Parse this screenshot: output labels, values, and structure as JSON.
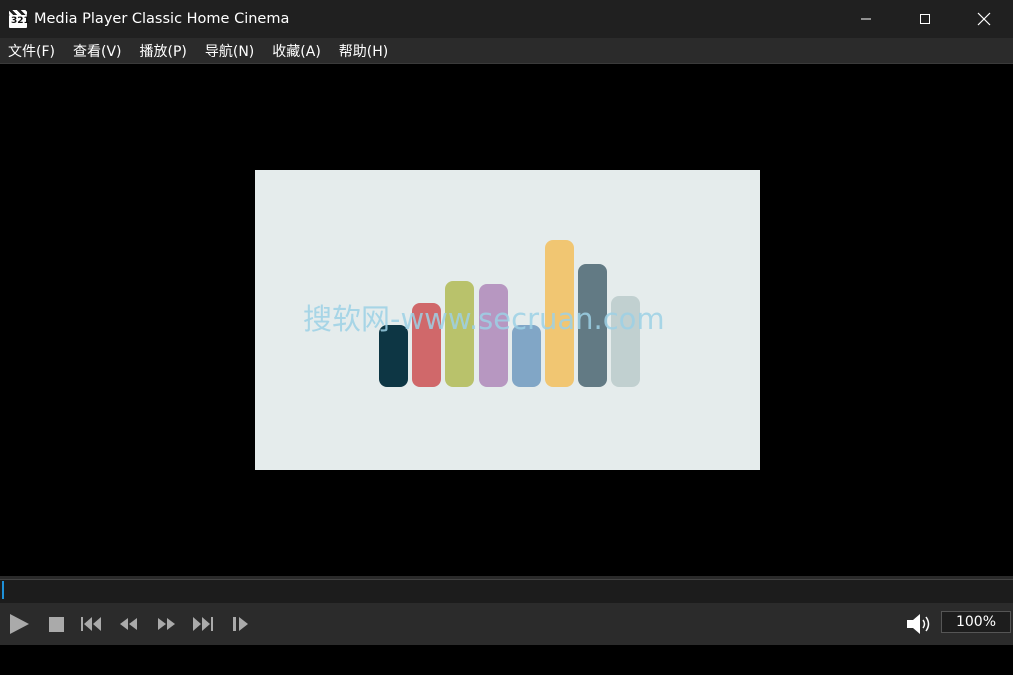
{
  "window": {
    "title": "Media Player Classic Home Cinema",
    "icon_number": "321"
  },
  "menu": [
    {
      "label": "文件(F)"
    },
    {
      "label": "查看(V)"
    },
    {
      "label": "播放(P)"
    },
    {
      "label": "导航(N)"
    },
    {
      "label": "收藏(A)"
    },
    {
      "label": "帮助(H)"
    }
  ],
  "video": {
    "background": "#e5ecec",
    "watermark": "搜软网-www.secruan.com",
    "bars": [
      {
        "color": "#0d3644",
        "level": 0.42
      },
      {
        "color": "#d0686a",
        "level": 0.57
      },
      {
        "color": "#b9c26b",
        "level": 0.72
      },
      {
        "color": "#b797c1",
        "level": 0.7
      },
      {
        "color": "#81a6c6",
        "level": 0.42
      },
      {
        "color": "#f1c672",
        "level": 1.0
      },
      {
        "color": "#627a84",
        "level": 0.84
      },
      {
        "color": "#c1d0d0",
        "level": 0.62
      }
    ]
  },
  "seekbar": {
    "position": 0.0
  },
  "controls": {
    "play": "play-icon",
    "stop": "stop-icon",
    "prev": "skip-back-icon",
    "rewind": "rewind-icon",
    "forward": "fast-forward-icon",
    "next": "skip-forward-icon",
    "frame_step": "frame-step-icon",
    "volume": "speaker-icon",
    "zoom": "100%"
  },
  "colors": {
    "accent": "#1e90d8"
  }
}
